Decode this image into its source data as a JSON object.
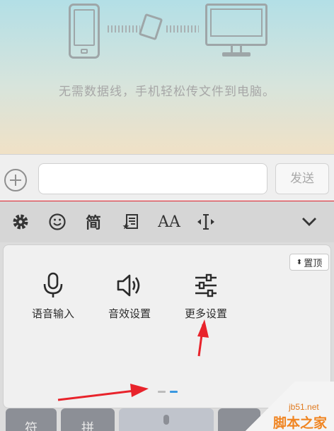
{
  "hero": {
    "hint": "无需数据线，手机轻松传文件到电脑。",
    "icons": [
      "phone-icon",
      "file-icon",
      "monitor-icon"
    ]
  },
  "input_bar": {
    "plus_icon": "plus-circle-icon",
    "message_placeholder": "",
    "send_label": "发送"
  },
  "toolbar": {
    "items": [
      {
        "icon": "gear-icon"
      },
      {
        "icon": "smiley-icon"
      },
      {
        "label": "简"
      },
      {
        "icon": "clipboard-star-icon"
      },
      {
        "label": "AA"
      },
      {
        "icon": "cursor-move-icon"
      },
      {
        "icon": "chevron-down-icon"
      }
    ]
  },
  "panel": {
    "pin_label": "置顶",
    "features": [
      {
        "label": "语音输入",
        "icon": "microphone-icon"
      },
      {
        "label": "音效设置",
        "icon": "speaker-icon"
      },
      {
        "label": "更多设置",
        "icon": "sliders-icon"
      }
    ],
    "pages": 2,
    "active_page": 2
  },
  "keys": [
    "符",
    "拼"
  ],
  "watermark": {
    "url": "jb51.net",
    "name": "脚本之家"
  },
  "colors": {
    "annotation_arrow": "#e8232b",
    "active_dot": "#3a98e0",
    "watermark": "#f08522"
  }
}
